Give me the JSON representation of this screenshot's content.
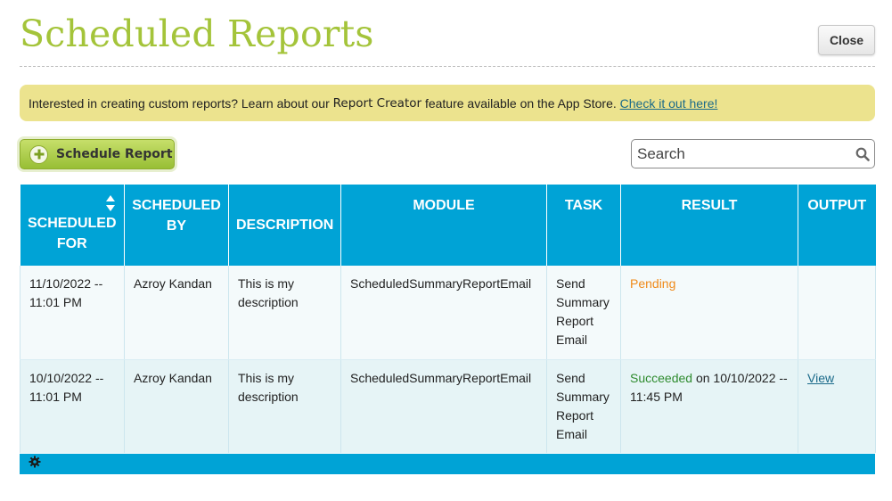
{
  "header": {
    "title": "Scheduled Reports",
    "close_label": "Close"
  },
  "banner": {
    "text_before": "Interested in creating custom reports? Learn about our",
    "feature_name": "Report Creator",
    "text_after": "feature available on the App Store.",
    "link_label": "Check it out here!"
  },
  "toolbar": {
    "schedule_label": "Schedule Report",
    "search_placeholder": "Search"
  },
  "table": {
    "columns": {
      "scheduled_for": "SCHEDULED FOR",
      "scheduled_by": "SCHEDULED BY",
      "description": "DESCRIPTION",
      "module": "MODULE",
      "task": "TASK",
      "result": "RESULT",
      "output": "OUTPUT"
    },
    "rows": [
      {
        "scheduled_for": "11/10/2022 -- 11:01 PM",
        "scheduled_by": "Azroy Kandan",
        "description": "This is my description",
        "module": "ScheduledSummaryReportEmail",
        "task": "Send Summary Report Email",
        "result_status": "Pending",
        "result_detail": "",
        "output": ""
      },
      {
        "scheduled_for": "10/10/2022 -- 11:01 PM",
        "scheduled_by": "Azroy Kandan",
        "description": "This is my description",
        "module": "ScheduledSummaryReportEmail",
        "task": "Send Summary Report Email",
        "result_status": "Succeeded",
        "result_detail": "on 10/10/2022 -- 11:45 PM",
        "output": "View"
      }
    ]
  },
  "colors": {
    "title_green": "#a4c43a",
    "header_blue": "#00a3d6",
    "banner_yellow": "#ece38e",
    "pending_orange": "#ef8a1a",
    "succeeded_green": "#2e8b2e"
  },
  "icons": [
    "plus-icon",
    "search-icon",
    "sort-icon",
    "gear-icon"
  ]
}
